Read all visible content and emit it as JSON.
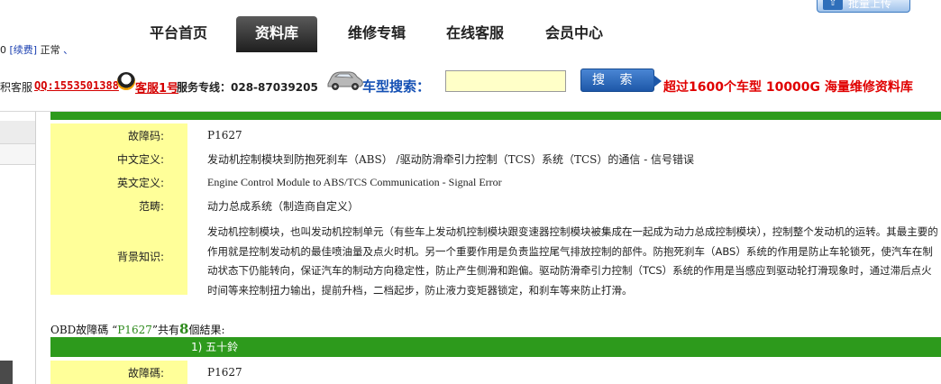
{
  "top": {
    "status_left": "0",
    "renew_link": "[续费]",
    "status_text": "正常",
    "dot_link": "、",
    "upload_button": "批量上传"
  },
  "nav": {
    "items": [
      "平台首页",
      "资料库",
      "维修专辑",
      "在线客服",
      "会员中心"
    ],
    "active_index": 1
  },
  "service": {
    "prefix": "积客服",
    "qq_link": "QQ:1553501388",
    "kefu_link": "客服1号",
    "hotline": "服务专线：028-87039205",
    "car_search_label": "车型搜索：",
    "search_value": "",
    "search_button": "搜 索",
    "promo": "超过1600个车型  10000G 海量维修资料库"
  },
  "result_top": {
    "bar_label": "",
    "rows": [
      {
        "label": "故障码:",
        "value": "P1627"
      },
      {
        "label": "中文定义:",
        "value": "发动机控制模块到防抱死刹车（ABS）  /驱动防滑牵引力控制（TCS）系统（TCS）的通信  - 信号错误"
      },
      {
        "label": "英文定义:",
        "value": "Engine Control Module to ABS/TCS Communication - Signal Error"
      },
      {
        "label": "范畴:",
        "value": "动力总成系统（制造商自定义）"
      },
      {
        "label": "背景知识:",
        "value": "发动机控制模块，也叫发动机控制单元（有些车上发动机控制模块跟变速器控制模块被集成在一起成为动力总成控制模块），控制整个发动机的运转。其最主要的作用就是控制发动机的最佳喷油量及点火时机。另一个重要作用是负责监控尾气排放控制的部件。防抱死刹车（ABS）系统的作用是防止车轮锁死，使汽车在制动状态下仍能转向，保证汽车的制动方向稳定性，防止产生侧滑和跑偏。驱动防滑牵引力控制（TCS）系统的作用是当感应到驱动轮打滑现象时，通过滞后点火时间等来控制扭力输出，提前升档，二档起步，防止液力变矩器锁定，和刹车等来防止打滑。"
      }
    ]
  },
  "result_summary": {
    "prefix": "OBD故障碼  “",
    "code": "P1627",
    "middle": "”共有",
    "count": "8",
    "suffix": "個結果:"
  },
  "result_second": {
    "bar_label": "1) 五十鈴",
    "rows": [
      {
        "label": "故障碼:",
        "value": "P1627"
      }
    ]
  },
  "colors": {
    "green_bar": "#2d9a1c",
    "label_bg": "#ffff99",
    "promo": "#e00000",
    "link_red": "#d40000",
    "accent_blue": "#1450b4"
  }
}
